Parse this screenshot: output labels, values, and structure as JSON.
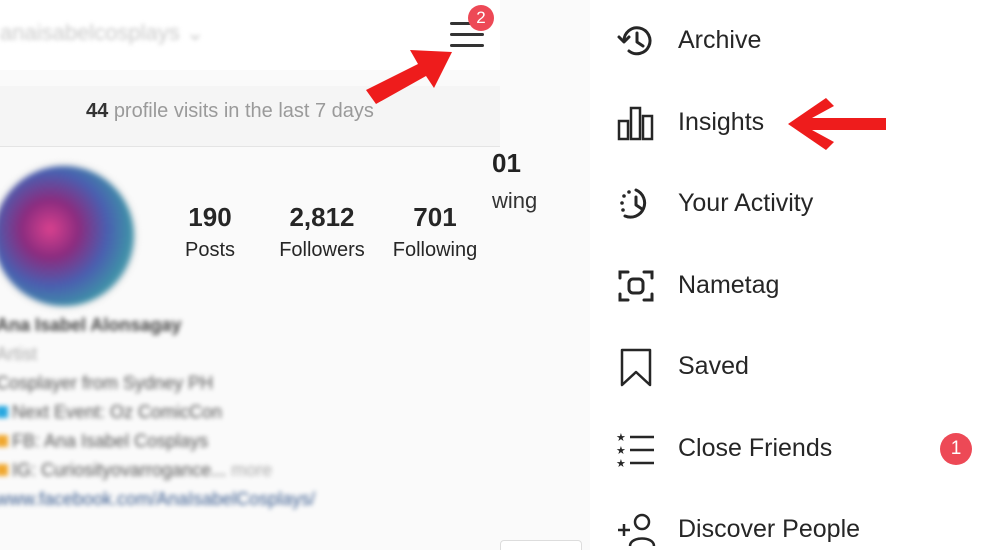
{
  "profile": {
    "username": "anaisabelcosplays",
    "notification_count": "2",
    "visits_count": "44",
    "visits_text": "profile visits in the last 7 days",
    "partial_stat_num": "01",
    "partial_stat_label": "wing",
    "stats": [
      {
        "value": "190",
        "label": "Posts"
      },
      {
        "value": "2,812",
        "label": "Followers"
      },
      {
        "value": "701",
        "label": "Following"
      }
    ],
    "bio": {
      "name": "Ana Isabel Alonsagay",
      "category": "Artist",
      "lines": [
        "Cosplayer from Sydney PH",
        "Next Event: Oz ComicCon",
        "FB: Ana Isabel Cosplays",
        "IG: Curiosityovarrogance...",
        "www.facebook.com/AnaIsabelCosplays/"
      ],
      "more": "more"
    }
  },
  "menu": {
    "items": [
      {
        "label": "Archive",
        "icon": "archive-icon"
      },
      {
        "label": "Insights",
        "icon": "insights-icon"
      },
      {
        "label": "Your Activity",
        "icon": "activity-icon"
      },
      {
        "label": "Nametag",
        "icon": "nametag-icon"
      },
      {
        "label": "Saved",
        "icon": "saved-icon"
      },
      {
        "label": "Close Friends",
        "icon": "close-friends-icon",
        "badge": "1"
      },
      {
        "label": "Discover People",
        "icon": "discover-people-icon"
      }
    ]
  },
  "colors": {
    "badge": "#ed4956",
    "annotation_arrow": "#ee1c1c",
    "text": "#262626"
  }
}
